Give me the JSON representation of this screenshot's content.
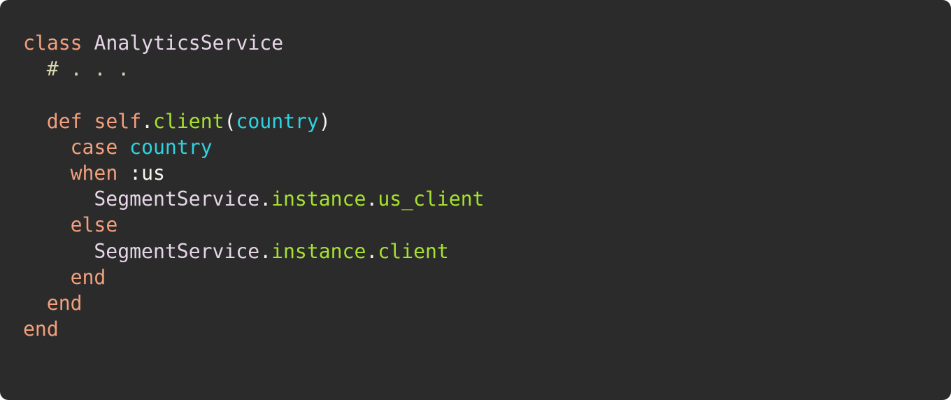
{
  "colors": {
    "background": "#2b2b2b",
    "keyword": "#f2a07e",
    "constant": "#e5d5e6",
    "comment": "#d8d8b0",
    "method": "#a6e22e",
    "parameter": "#2fd3e0",
    "punctuation": "#f2f2f2"
  },
  "code": {
    "line1": {
      "kw": "class",
      "sp": " ",
      "name": "AnalyticsService"
    },
    "line2": {
      "comment": "# . . ."
    },
    "line4": {
      "kw": "def",
      "sp": " ",
      "self": "self",
      "dot": ".",
      "method": "client",
      "open": "(",
      "param": "country",
      "close": ")"
    },
    "line5": {
      "kw": "case",
      "sp": " ",
      "param": "country"
    },
    "line6": {
      "kw": "when",
      "sp": " ",
      "symbol": ":us"
    },
    "line7": {
      "const": "SegmentService",
      "dot1": ".",
      "m1": "instance",
      "dot2": ".",
      "m2": "us_client"
    },
    "line8": {
      "kw": "else"
    },
    "line9": {
      "const": "SegmentService",
      "dot1": ".",
      "m1": "instance",
      "dot2": ".",
      "m2": "client"
    },
    "line10": {
      "kw": "end"
    },
    "line11": {
      "kw": "end"
    },
    "line12": {
      "kw": "end"
    }
  }
}
